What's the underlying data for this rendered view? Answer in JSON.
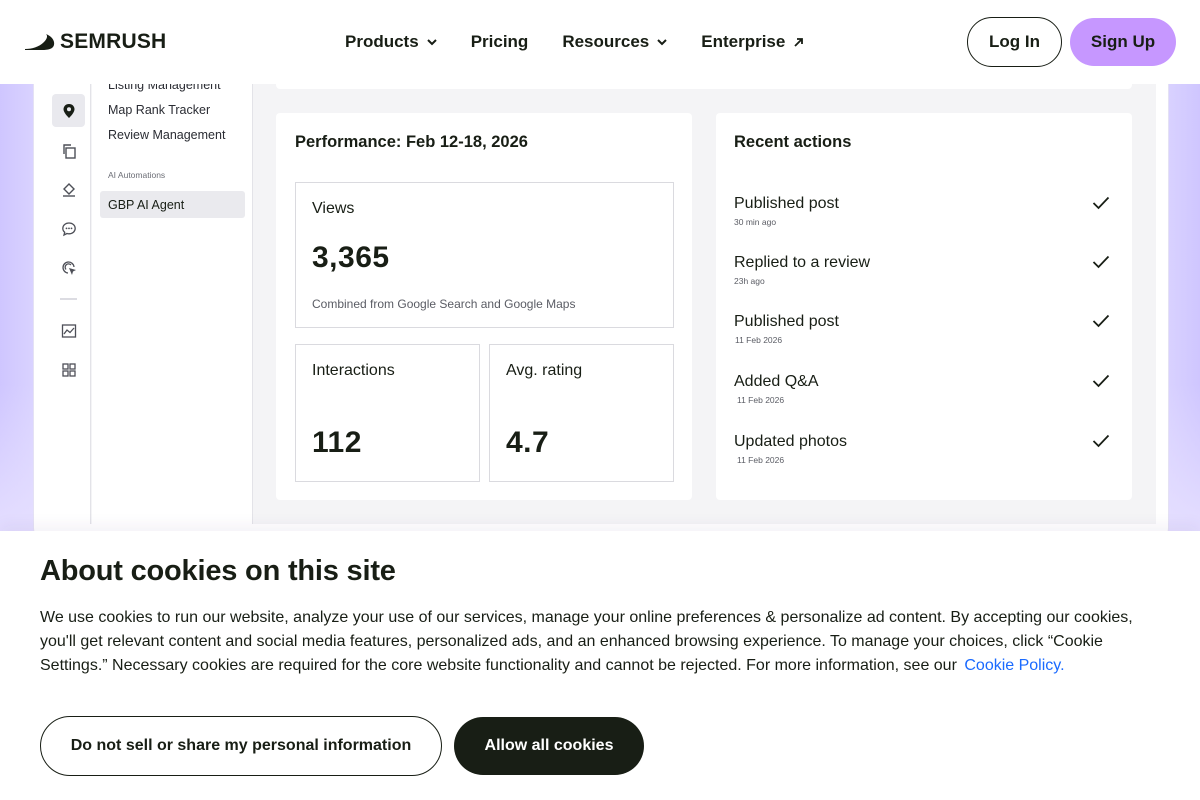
{
  "header": {
    "logo_text": "SEMRUSH",
    "nav": [
      {
        "label": "Products",
        "icon": "chevron-down-icon"
      },
      {
        "label": "Pricing"
      },
      {
        "label": "Resources",
        "icon": "chevron-down-icon"
      },
      {
        "label": "Enterprise",
        "icon": "external-arrow-icon"
      }
    ],
    "login_label": "Log In",
    "signup_label": "Sign Up",
    "signup_color": "#c697ff"
  },
  "dashboard": {
    "rail_icons": [
      "location-pin-icon",
      "copy-icon",
      "layers-icon",
      "chat-icon",
      "cursor-target-icon",
      "chart-icon",
      "grid-icon"
    ],
    "menu": {
      "items": [
        "Listing Management",
        "Map Rank Tracker",
        "Review Management"
      ],
      "section_label": "AI Automations",
      "active_item": "GBP AI Agent"
    },
    "performance": {
      "title": "Performance: Feb 12-18, 2026",
      "views": {
        "label": "Views",
        "value": "3,365",
        "note": "Combined from Google Search and Google Maps"
      },
      "interactions": {
        "label": "Interactions",
        "value": "112"
      },
      "rating": {
        "label": "Avg. rating",
        "value": "4.7"
      }
    },
    "recent": {
      "title": "Recent actions",
      "actions": [
        {
          "title": "Published post",
          "time": "30 min ago"
        },
        {
          "title": "Replied to a review",
          "time": "23h ago"
        },
        {
          "title": "Published post",
          "time": "11 Feb 2026"
        },
        {
          "title": "Added Q&A",
          "time": "11 Feb 2026"
        },
        {
          "title": "Updated photos",
          "time": "11 Feb 2026"
        }
      ]
    }
  },
  "cookie": {
    "title": "About cookies on this site",
    "body": "We use cookies to run our website, analyze your use of our services, manage your online preferences & personalize ad content. By accepting our cookies, you'll get relevant content and social media features, personalized ads, and an enhanced browsing experience. To manage your choices, click “Cookie Settings.” Necessary cookies are required for the core website functionality and cannot be rejected. For more information, see our",
    "link_label": "Cookie Policy.",
    "link_color": "#1a6aff",
    "decline_label": "Do not sell or share my personal information",
    "accept_label": "Allow all cookies"
  }
}
